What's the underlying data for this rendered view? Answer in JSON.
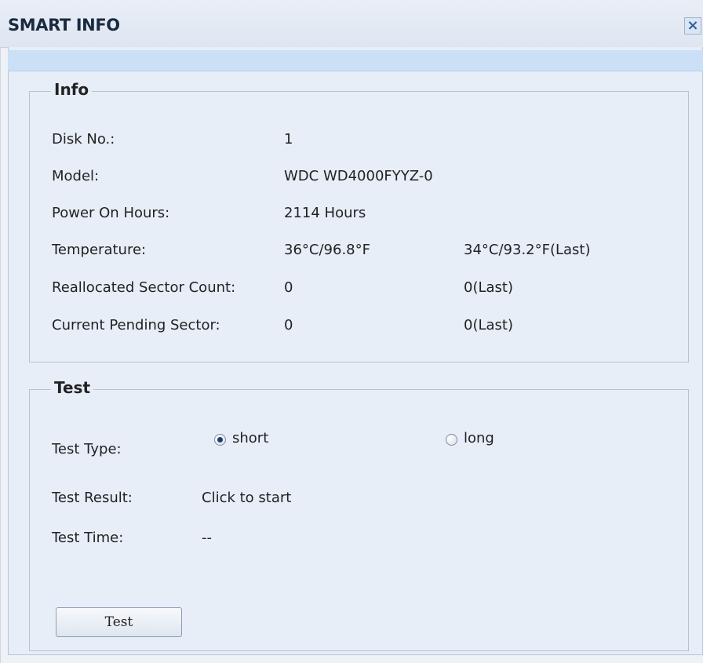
{
  "window": {
    "title": "SMART INFO",
    "close_label": "×"
  },
  "info": {
    "legend": "Info",
    "rows": [
      {
        "label": "Disk No.:",
        "value": "1",
        "last": ""
      },
      {
        "label": "Model:",
        "value": "WDC WD4000FYYZ-0",
        "last": ""
      },
      {
        "label": "Power On Hours:",
        "value": "2114 Hours",
        "last": ""
      },
      {
        "label": "Temperature:",
        "value": "36°C/96.8°F",
        "last": "34°C/93.2°F(Last)"
      },
      {
        "label": "Reallocated Sector Count:",
        "value": "0",
        "last": "0(Last)"
      },
      {
        "label": "Current Pending Sector:",
        "value": "0",
        "last": "0(Last)"
      }
    ]
  },
  "test": {
    "legend": "Test",
    "type_label": "Test Type:",
    "options": [
      {
        "label": "short",
        "selected": true
      },
      {
        "label": "long",
        "selected": false
      }
    ],
    "result_label": "Test Result:",
    "result_value": "Click to start",
    "time_label": "Test Time:",
    "time_value": "--",
    "button_label": "Test"
  }
}
